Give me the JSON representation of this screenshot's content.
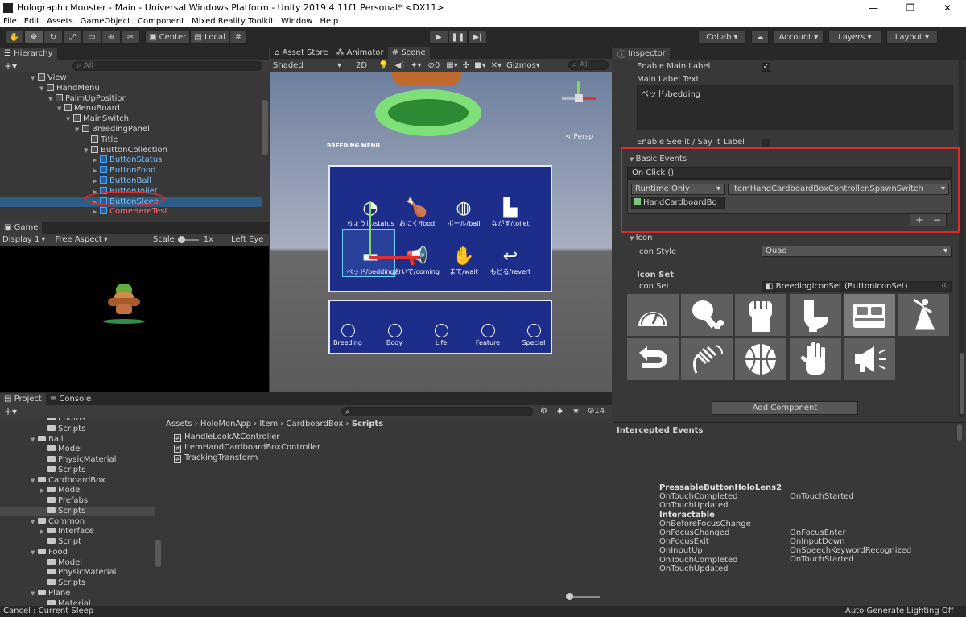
{
  "window": {
    "title": "HolographicMonster - Main - Universal Windows Platform - Unity 2019.4.11f1 Personal* <DX11>"
  },
  "menu": [
    "File",
    "Edit",
    "Assets",
    "GameObject",
    "Component",
    "Mixed Reality Toolkit",
    "Window",
    "Help"
  ],
  "toolbar": {
    "center": "Center",
    "local": "Local",
    "collab": "Collab",
    "account": "Account",
    "layers": "Layers",
    "layout": "Layout"
  },
  "hierarchy": {
    "tab": "Hierarchy",
    "search_placeholder": "All",
    "rows": [
      {
        "label": "View",
        "indent": 0,
        "blue": false
      },
      {
        "label": "HandMenu",
        "indent": 1,
        "blue": false
      },
      {
        "label": "PalmUpPosition",
        "indent": 2,
        "blue": false
      },
      {
        "label": "MenuBoard",
        "indent": 3,
        "blue": false
      },
      {
        "label": "MainSwitch",
        "indent": 4,
        "blue": false
      },
      {
        "label": "BreedingPanel",
        "indent": 5,
        "blue": false
      },
      {
        "label": "Title",
        "indent": 6,
        "blue": false
      },
      {
        "label": "ButtonCollection",
        "indent": 6,
        "blue": false
      },
      {
        "label": "ButtonStatus",
        "indent": 7,
        "blue": true
      },
      {
        "label": "ButtonFood",
        "indent": 7,
        "blue": true
      },
      {
        "label": "ButtonBall",
        "indent": 7,
        "blue": true
      },
      {
        "label": "ButtonToilet",
        "indent": 7,
        "blue": true
      },
      {
        "label": "ButtonSleep",
        "indent": 7,
        "blue": true
      },
      {
        "label": "ComeHereTest",
        "indent": 7,
        "blue": true
      }
    ]
  },
  "game": {
    "tab": "Game",
    "display": "Display 1",
    "aspect": "Free Aspect",
    "scale_label": "Scale",
    "scale_value": "1x",
    "eye": "Left Eye"
  },
  "scene": {
    "tabs": [
      "Asset Store",
      "Animator",
      "Scene"
    ],
    "shading": "Shaded",
    "mode_2d": "2D",
    "gizmos": "Gizmos",
    "search_placeholder": "All",
    "persp": "Persp",
    "breeding_title": "BREEDING MENU",
    "icons_top": [
      "ちょうし/status",
      "おにく/food",
      "ボール/ball",
      "ながす/toilet"
    ],
    "icons_bottom": [
      "ベッド/bedding",
      "おいで/coming",
      "まて/wait",
      "もどる/revert"
    ],
    "nav": [
      "Breeding",
      "Body",
      "Life",
      "Feature",
      "Special"
    ]
  },
  "project": {
    "tabs": [
      "Project",
      "Console"
    ],
    "tree": [
      {
        "label": "Enums",
        "indent": 3
      },
      {
        "label": "Scripts",
        "indent": 3
      },
      {
        "label": "Ball",
        "indent": 2
      },
      {
        "label": "Model",
        "indent": 3
      },
      {
        "label": "PhysicMaterial",
        "indent": 3
      },
      {
        "label": "Scripts",
        "indent": 3
      },
      {
        "label": "CardboardBox",
        "indent": 2
      },
      {
        "label": "Model",
        "indent": 3
      },
      {
        "label": "Prefabs",
        "indent": 3
      },
      {
        "label": "Scripts",
        "indent": 3
      },
      {
        "label": "Common",
        "indent": 2
      },
      {
        "label": "Interface",
        "indent": 3
      },
      {
        "label": "Script",
        "indent": 3
      },
      {
        "label": "Food",
        "indent": 2
      },
      {
        "label": "Model",
        "indent": 3
      },
      {
        "label": "PhysicMaterial",
        "indent": 3
      },
      {
        "label": "Scripts",
        "indent": 3
      },
      {
        "label": "Plane",
        "indent": 2
      },
      {
        "label": "Material",
        "indent": 3
      }
    ],
    "breadcrumb": [
      "Assets",
      "HoloMonApp",
      "Item",
      "CardboardBox",
      "Scripts"
    ],
    "files": [
      "HandleLookAtController",
      "ItemHandCardboardBoxController",
      "TrackingTransform"
    ],
    "count": "14"
  },
  "inspector": {
    "tab": "Inspector",
    "enable_main_label": "Enable Main Label",
    "main_label_text": "Main Label Text",
    "main_label_value": "ベッド/bedding",
    "enable_see_it": "Enable See it / Say it Label",
    "basic_events": "Basic Events",
    "on_click": "On Click ()",
    "runtime": "Runtime Only",
    "function": "ItemHandCardboardBoxController.SpawnSwitch",
    "object": "HandCardboardBo",
    "plus": "+",
    "minus": "−",
    "icon": "Icon",
    "icon_style_label": "Icon Style",
    "icon_style_value": "Quad",
    "icon_set_header": "Icon Set",
    "icon_set_label": "Icon Set",
    "icon_set_value": "BreedingIconSet (ButtonIconSet)",
    "add_component": "Add Component",
    "intercepted": "Intercepted Events",
    "events_left": [
      "PressableButtonHoloLens2",
      "OnTouchCompleted",
      "OnTouchUpdated",
      "Interactable",
      "OnBeforeFocusChange",
      "OnFocusChanged",
      "OnFocusExit",
      "OnInputUp",
      "OnTouchCompleted",
      "OnTouchUpdated"
    ],
    "events_right": [
      "OnTouchStarted",
      "OnFocusEnter",
      "OnInputDown",
      "OnSpeechKeywordRecognized",
      "OnTouchStarted"
    ]
  },
  "status": {
    "left": "Cancel : Current Sleep",
    "right": "Auto Generate Lighting Off"
  }
}
